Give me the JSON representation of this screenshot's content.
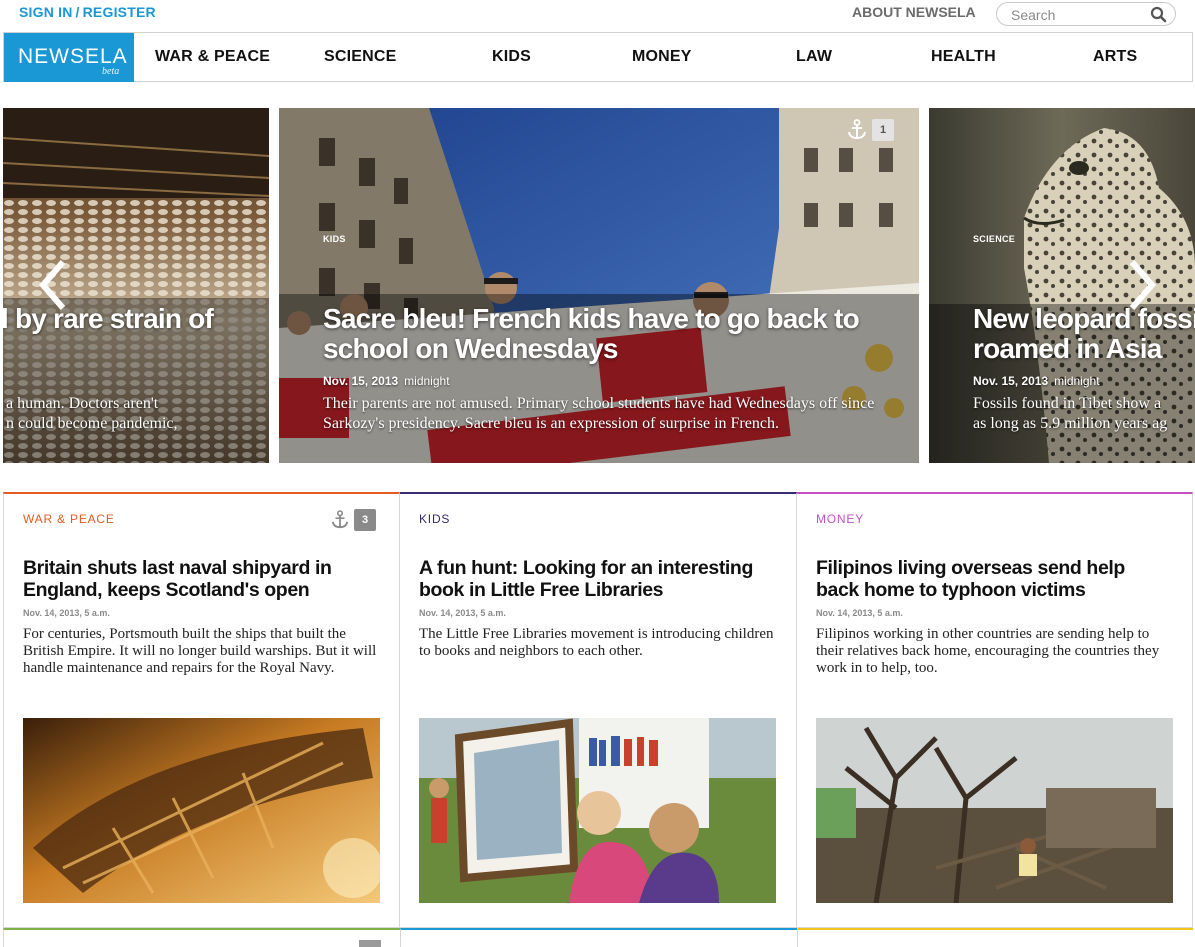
{
  "topbar": {
    "sign_in": "SIGN IN",
    "separator": "/",
    "register": "REGISTER",
    "about": "ABOUT NEWSELA",
    "search_placeholder": "Search"
  },
  "nav": {
    "logo": "NEWSELA",
    "logo_tag": "beta",
    "items": [
      "WAR & PEACE",
      "SCIENCE",
      "KIDS",
      "MONEY",
      "LAW",
      "HEALTH",
      "ARTS"
    ]
  },
  "carousel": {
    "left": {
      "title": "l by rare strain of",
      "desc_line1": "a human. Doctors aren't",
      "desc_line2": "n could become pandemic,"
    },
    "main": {
      "tag": "KIDS",
      "title_line1": "Sacre bleu! French kids have to go back to",
      "title_line2": "school on Wednesdays",
      "date": "Nov. 15, 2013",
      "time": "midnight",
      "desc": "Their parents are not amused. Primary school students have had Wednesdays off since Sarkozy's presidency. Sacre bleu is an expression of surprise in French.",
      "anchor_count": "1"
    },
    "right": {
      "tag": "SCIENCE",
      "title_line1": "New leopard fossi",
      "title_line2": "roamed in Asia",
      "date": "Nov. 15, 2013",
      "time": "midnight",
      "desc_line1": "Fossils found in Tibet show a",
      "desc_line2": "as long as 5.9 million years ag"
    }
  },
  "cards": [
    {
      "category": "WAR & PEACE",
      "category_color": "#e35b1f",
      "title": "Britain shuts last naval shipyard in England, keeps Scotland's open",
      "date": "Nov. 14, 2013, 5 a.m.",
      "desc": "For centuries, Portsmouth built the ships that built the British Empire. It will no longer build warships. But it will handle maintenance and repairs for the Royal Navy.",
      "anchor_count": "3"
    },
    {
      "category": "KIDS",
      "category_color": "#3a2a6e",
      "title": "A fun hunt: Looking for an interesting book in Little Free Libraries",
      "date": "Nov. 14, 2013, 5 a.m.",
      "desc": "The Little Free Libraries movement is introducing children to books and neighbors to each other."
    },
    {
      "category": "MONEY",
      "category_color": "#c64fc4",
      "title": "Filipinos living overseas send help back home to typhoon victims",
      "date": "Nov. 14, 2013, 5 a.m.",
      "desc": "Filipinos working in other countries are sending help to their relatives back home, encouraging the countries they work in to help, too."
    }
  ],
  "colors": {
    "brand_blue": "#1a98d5",
    "war_peace": "#e35b1f",
    "kids": "#3a2a6e",
    "money": "#c64fc4",
    "science": "#7fb045",
    "law": "#1a98d5",
    "health": "#f0c419"
  },
  "icons": [
    "search-icon",
    "anchor-icon",
    "chevron-left-icon",
    "chevron-right-icon"
  ]
}
